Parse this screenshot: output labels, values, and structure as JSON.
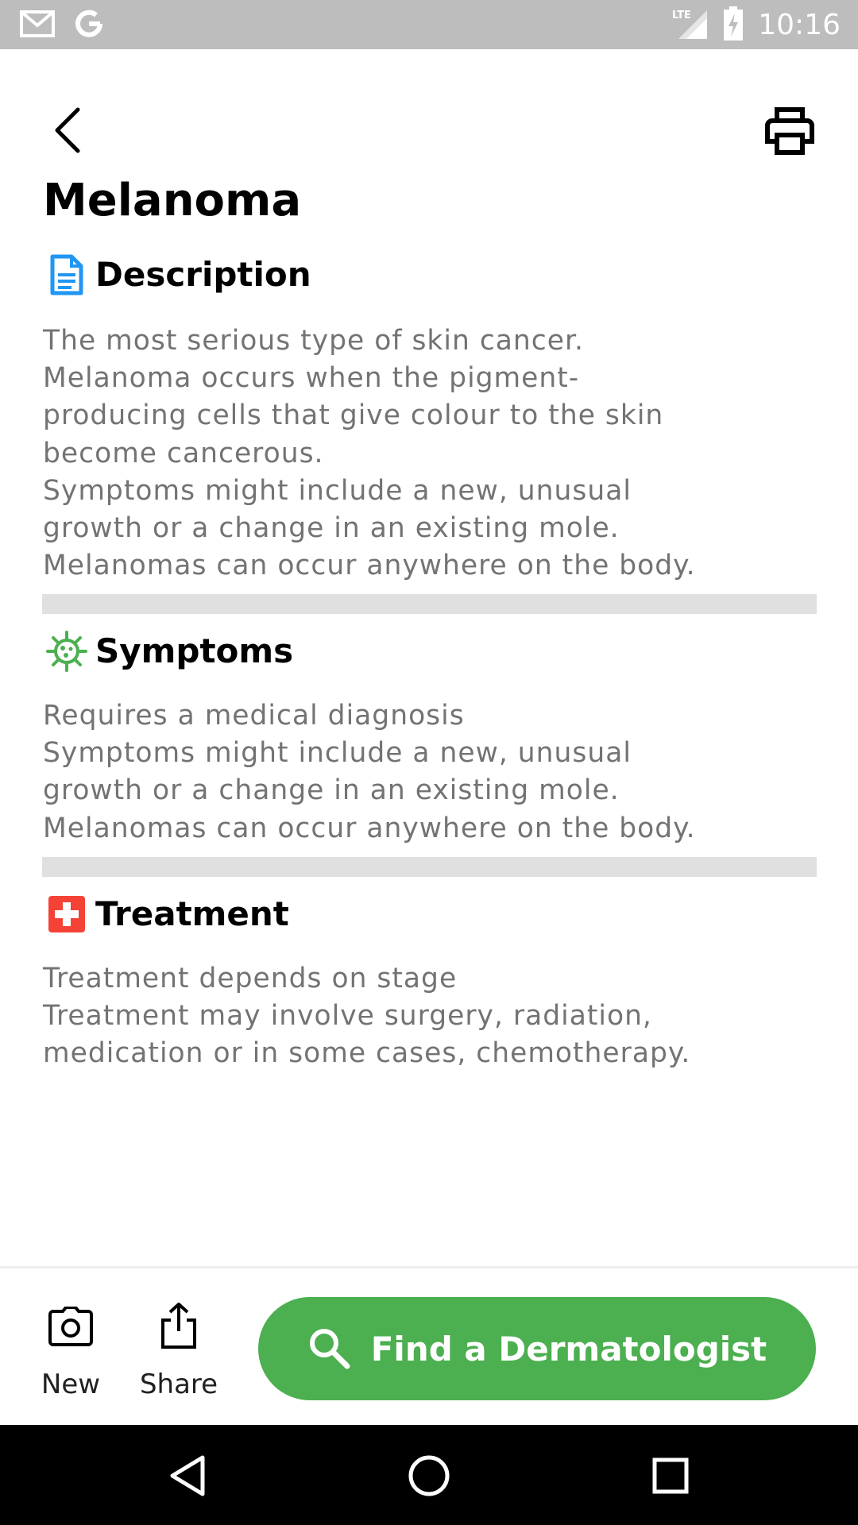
{
  "status_bar": {
    "time": "10:16",
    "left_icons": [
      "gmail-icon",
      "google-icon"
    ],
    "right_icons": [
      "lte-signal-icon",
      "battery-charging-icon"
    ]
  },
  "header": {
    "back_icon": "chevron-left-icon",
    "print_icon": "printer-icon",
    "title": "Melanoma"
  },
  "sections": [
    {
      "title": "Description",
      "icon": "document-icon",
      "icon_color": "#2196f3",
      "lines": [
        "The most serious type of skin cancer.",
        "Melanoma occurs when the pigment-",
        "producing cells that give colour to the skin",
        "become cancerous.",
        "Symptoms might include a new, unusual",
        "growth or a change in an existing mole.",
        "Melanomas can occur anywhere on the body."
      ]
    },
    {
      "title": "Symptoms",
      "icon": "virus-icon",
      "icon_color": "#4caf50",
      "lines": [
        "Requires a medical diagnosis",
        "Symptoms might include a new, unusual",
        "growth or a change in an existing mole.",
        "Melanomas can occur anywhere on the body."
      ]
    },
    {
      "title": "Treatment",
      "icon": "medical-cross-icon",
      "icon_color": "#f44336",
      "lines": [
        "Treatment depends on stage",
        "Treatment may involve surgery, radiation,",
        "medication or in some cases, chemotherapy."
      ]
    }
  ],
  "bottom_bar": {
    "new_label": "New",
    "new_icon": "camera-icon",
    "share_label": "Share",
    "share_icon": "share-icon",
    "find_label": "Find a Dermatologist",
    "find_icon": "search-icon",
    "accent_color": "#4caf50"
  },
  "nav_bar": {
    "icons": [
      "back-triangle-icon",
      "home-circle-icon",
      "recents-square-icon"
    ]
  }
}
